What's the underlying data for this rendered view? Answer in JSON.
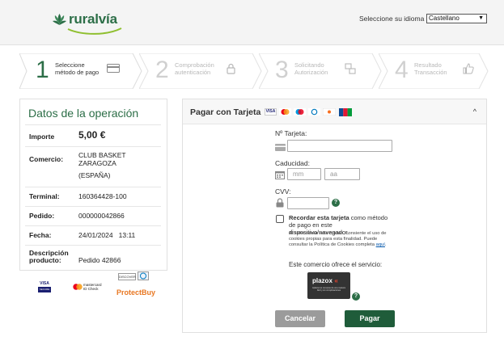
{
  "header": {
    "logo_text": "ruralvía",
    "language_label": "Seleccione su idioma",
    "language_value": "Castellano"
  },
  "steps": [
    {
      "number": "1",
      "label_line1": "Seleccione",
      "label_line2": "método de pago",
      "icon": "card-icon",
      "active": true
    },
    {
      "number": "2",
      "label_line1": "Comprobación",
      "label_line2": "autenticación",
      "icon": "lock-icon",
      "active": false
    },
    {
      "number": "3",
      "label_line1": "Solicitando",
      "label_line2": "Autorización",
      "icon": "transfer-icon",
      "active": false
    },
    {
      "number": "4",
      "label_line1": "Resultado",
      "label_line2": "Transacción",
      "icon": "thumbs-up-icon",
      "active": false
    }
  ],
  "operation": {
    "title": "Datos de la operación",
    "rows": [
      {
        "key": "Importe",
        "value": "5,00 €"
      },
      {
        "key": "Comercio:",
        "value_lines": [
          "CLUB BASKET",
          "ZARAGOZA",
          "(ESPAÑA)"
        ]
      },
      {
        "key": "Terminal:",
        "value": "160364428-100"
      },
      {
        "key": "Pedido:",
        "value": "000000042866"
      },
      {
        "key": "Fecha:",
        "value": "24/01/2024   13:11"
      },
      {
        "key_lines": [
          "Descripción",
          "producto:"
        ],
        "value": "Pedido 42866"
      }
    ]
  },
  "left_logos": {
    "visa_label": "VISA",
    "visa_sub": "SECURE",
    "mc_label1": "mastercard",
    "mc_label2": "ID Check",
    "discover_label": "DISCOVER",
    "protectbuy_label": "ProtectBuy"
  },
  "payment": {
    "title": "Pagar con Tarjeta",
    "card_brands": [
      "VISA",
      "MC",
      "MAESTRO",
      "DINERS",
      "DISCOVER",
      "JCB"
    ],
    "card_number_label": "Nº Tarjeta:",
    "card_number_value": "",
    "expiry_label": "Caducidad:",
    "month_placeholder": "mm",
    "year_placeholder": "aa",
    "cvv_label": "CVV:",
    "cvv_value": "",
    "remember_bold": "Recordar esta tarjeta",
    "remember_rest": " como método de pago en este dispositivo/navegador.",
    "cookies_text": "Al seleccionar esta opción, consiente el uso de cookies propias para esta finalidad. Puede consultar la Política de Cookies completa ",
    "cookies_link": "aquí",
    "cookies_end": ".",
    "service_text": "Este comercio ofrece el servicio:",
    "plazox_label": "plazox",
    "plazox_sub": "Aplaza tus compras de una manera fácil y sin complicaciones",
    "cancel_label": "Cancelar",
    "pay_label": "Pagar"
  },
  "colors": {
    "brand_green": "#2c6e47",
    "cancel_gray": "#9b9b9b",
    "plazox_red": "#e8432e"
  }
}
